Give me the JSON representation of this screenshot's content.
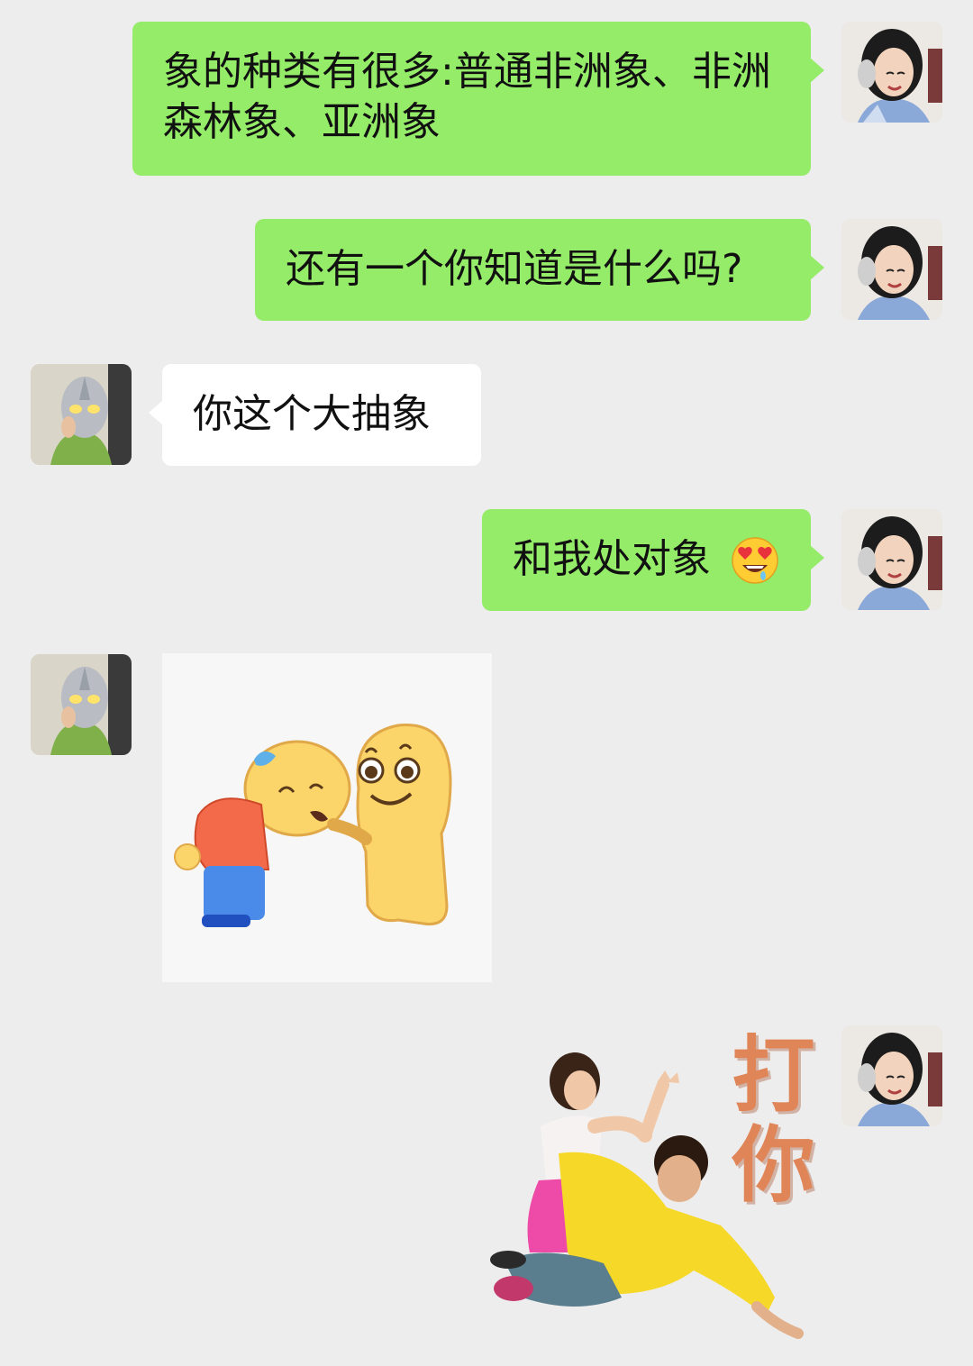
{
  "chat": {
    "messages": [
      {
        "id": "m1",
        "sender": "me",
        "type": "text",
        "text": "象的种类有很多:普通非洲象、非洲森林象、亚洲象"
      },
      {
        "id": "m2",
        "sender": "me",
        "type": "text",
        "text": "还有一个你知道是什么吗?"
      },
      {
        "id": "m3",
        "sender": "friend",
        "type": "text",
        "text": "你这个大抽象"
      },
      {
        "id": "m4",
        "sender": "me",
        "type": "text",
        "text": "和我处对象",
        "emoji": "heart-eyes-drool-emoji"
      },
      {
        "id": "m5",
        "sender": "friend",
        "type": "sticker",
        "sticker": "yellow-blob-pat-head-sticker"
      },
      {
        "id": "m6",
        "sender": "me",
        "type": "sticker",
        "sticker": "couple-hit-you-sticker",
        "caption": "打你"
      }
    ]
  },
  "colors": {
    "background": "#ededed",
    "outgoing_bubble": "#95ec69",
    "incoming_bubble": "#ffffff",
    "sticker_text": "#e08558"
  },
  "icons": {
    "my_avatar": "girl-headphones-avatar",
    "friend_avatar": "masked-hero-avatar"
  }
}
